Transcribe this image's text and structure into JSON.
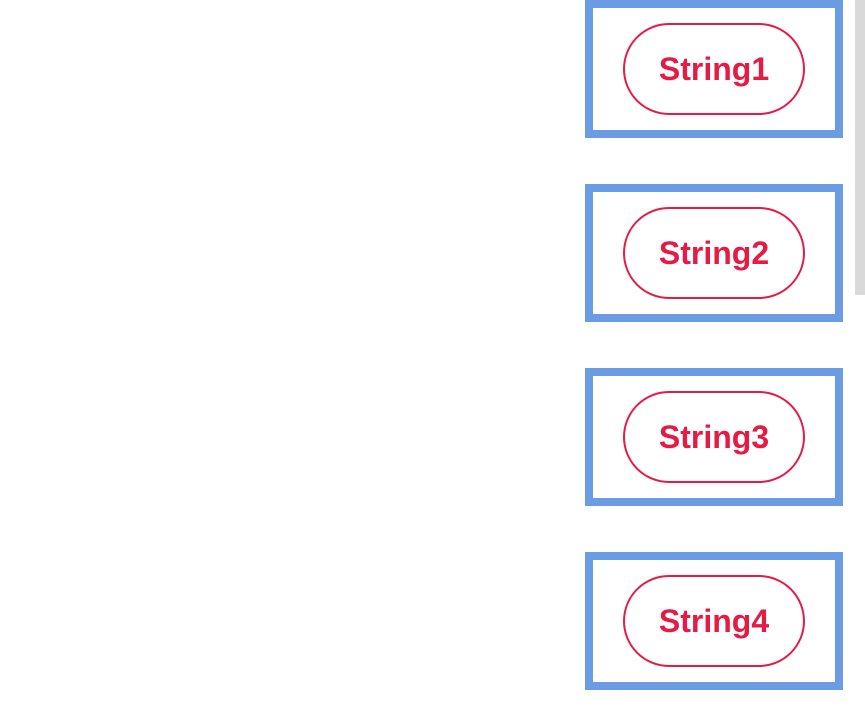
{
  "items": [
    {
      "label": "String1"
    },
    {
      "label": "String2"
    },
    {
      "label": "String3"
    },
    {
      "label": "String4"
    }
  ],
  "colors": {
    "box_border": "#6b9ce3",
    "pill_border": "#e31b45",
    "pill_text": "#e31b45",
    "side_bar": "#d9d9d9"
  }
}
